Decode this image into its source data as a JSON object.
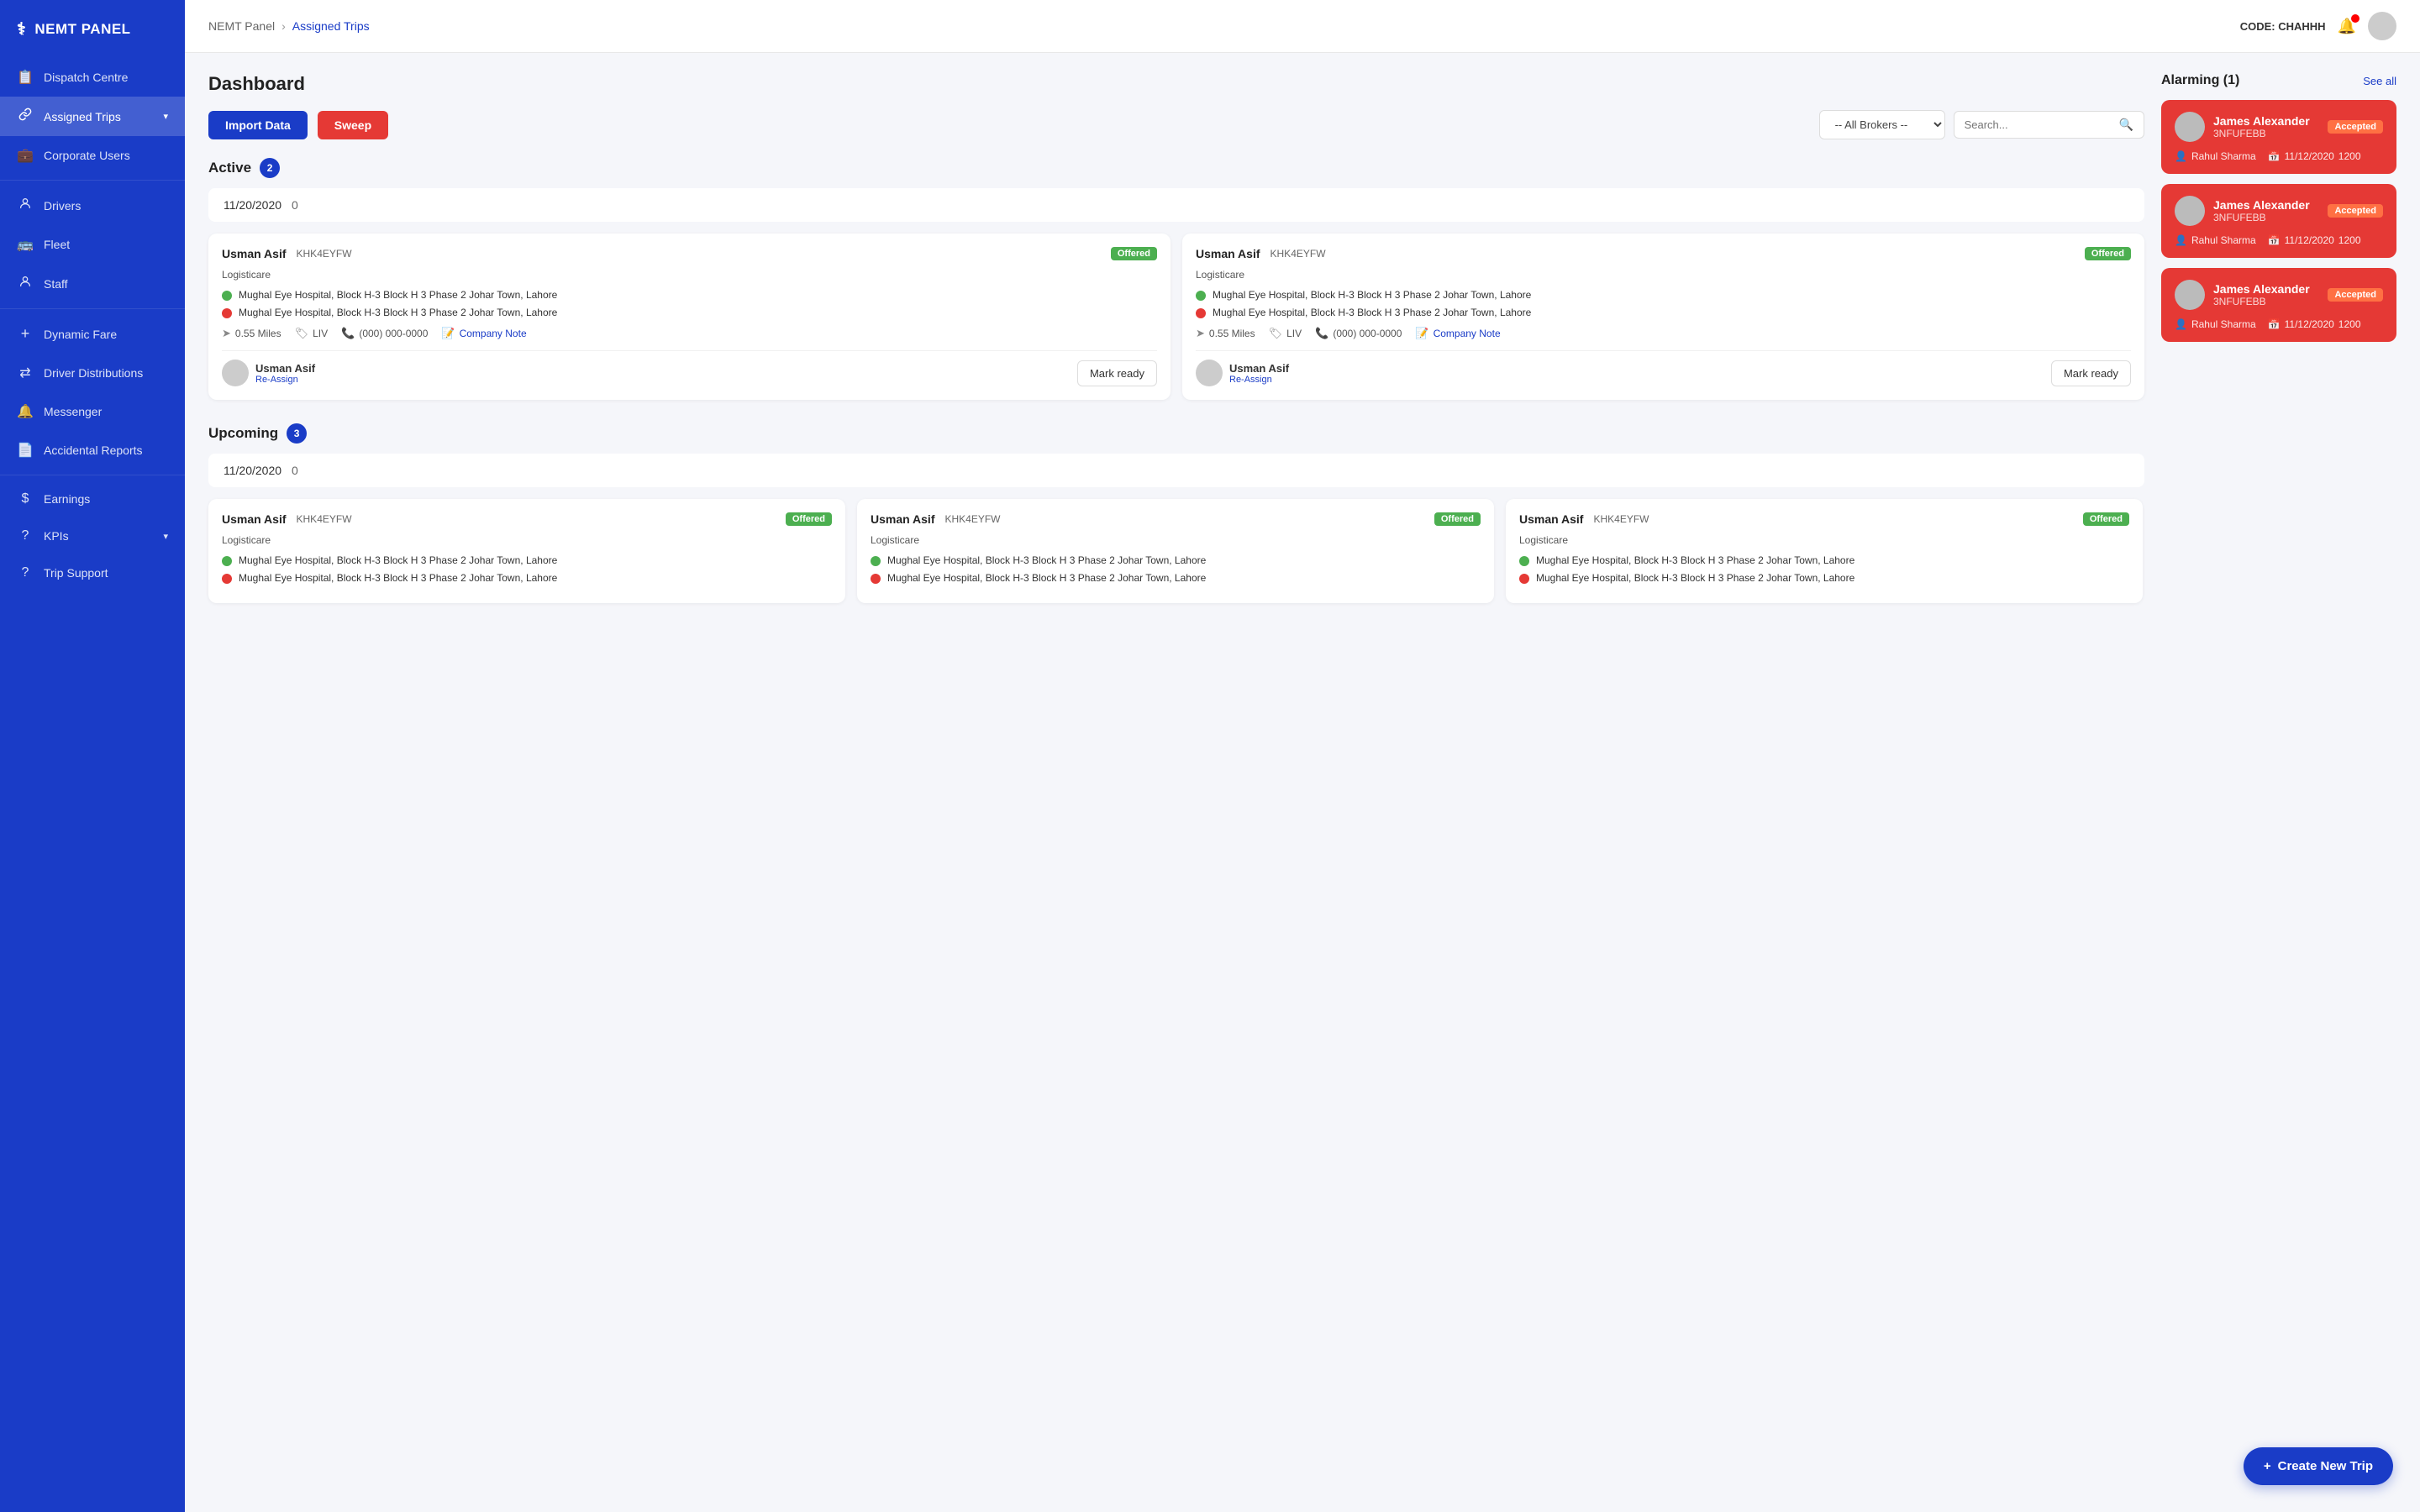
{
  "app": {
    "name": "NEMT PANEL",
    "logo_icon": "⚕"
  },
  "header": {
    "code_label": "CODE: CHAHHH",
    "breadcrumb_parent": "NEMT Panel",
    "breadcrumb_current": "Assigned Trips"
  },
  "sidebar": {
    "items": [
      {
        "id": "dispatch",
        "label": "Dispatch Centre",
        "icon": "📋",
        "active": false
      },
      {
        "id": "assigned-trips",
        "label": "Assigned Trips",
        "icon": "🔗",
        "active": true,
        "has_chevron": true
      },
      {
        "id": "corporate-users",
        "label": "Corporate Users",
        "icon": "💼",
        "active": false
      },
      {
        "id": "drivers",
        "label": "Drivers",
        "icon": "👤",
        "active": false
      },
      {
        "id": "fleet",
        "label": "Fleet",
        "icon": "🚌",
        "active": false
      },
      {
        "id": "staff",
        "label": "Staff",
        "icon": "👥",
        "active": false
      },
      {
        "id": "dynamic-fare",
        "label": "Dynamic Fare",
        "icon": "+",
        "active": false
      },
      {
        "id": "driver-distributions",
        "label": "Driver Distributions",
        "icon": "⇄",
        "active": false
      },
      {
        "id": "messenger",
        "label": "Messenger",
        "icon": "🔔",
        "active": false
      },
      {
        "id": "accidental-reports",
        "label": "Accidental Reports",
        "icon": "📄",
        "active": false
      },
      {
        "id": "earnings",
        "label": "Earnings",
        "icon": "$",
        "active": false
      },
      {
        "id": "kpis",
        "label": "KPIs",
        "icon": "?",
        "active": false,
        "has_chevron": true
      },
      {
        "id": "trip-support",
        "label": "Trip Support",
        "icon": "?",
        "active": false
      }
    ]
  },
  "toolbar": {
    "import_label": "Import Data",
    "sweep_label": "Sweep",
    "broker_placeholder": "-- All Brokers --",
    "search_placeholder": "Search..."
  },
  "dashboard": {
    "title": "Dashboard",
    "active_section": {
      "label": "Active",
      "count": 2,
      "date": "11/20/2020",
      "date_count": "0"
    },
    "upcoming_section": {
      "label": "Upcoming",
      "count": 3,
      "date": "11/20/2020",
      "date_count": "0"
    }
  },
  "active_trips": [
    {
      "driver_name": "Usman Asif",
      "trip_code": "KHK4EYFW",
      "status": "Offered",
      "company": "Logisticare",
      "pickup": "Mughal Eye Hospital, Block H-3 Block H 3 Phase 2 Johar Town, Lahore",
      "dropoff": "Mughal Eye Hospital, Block H-3 Block H 3 Phase 2 Johar Town, Lahore",
      "miles": "0.55 Miles",
      "tag": "LIV",
      "phone": "(000) 000-0000",
      "note_label": "Company Note",
      "assigned_driver": "Usman Asif",
      "reassign_label": "Re-Assign",
      "mark_ready_label": "Mark ready"
    },
    {
      "driver_name": "Usman Asif",
      "trip_code": "KHK4EYFW",
      "status": "Offered",
      "company": "Logisticare",
      "pickup": "Mughal Eye Hospital, Block H-3 Block H 3 Phase 2 Johar Town, Lahore",
      "dropoff": "Mughal Eye Hospital, Block H-3 Block H 3 Phase 2 Johar Town, Lahore",
      "miles": "0.55 Miles",
      "tag": "LIV",
      "phone": "(000) 000-0000",
      "note_label": "Company Note",
      "assigned_driver": "Usman Asif",
      "reassign_label": "Re-Assign",
      "mark_ready_label": "Mark ready"
    }
  ],
  "upcoming_trips": [
    {
      "driver_name": "Usman Asif",
      "trip_code": "KHK4EYFW",
      "status": "Offered",
      "company": "Logisticare",
      "pickup": "Mughal Eye Hospital, Block H-3 Block H 3 Phase 2 Johar Town, Lahore",
      "dropoff": "Mughal Eye Hospital, Block H-3 Block H 3 Phase 2 Johar Town, Lahore"
    },
    {
      "driver_name": "Usman Asif",
      "trip_code": "KHK4EYFW",
      "status": "Offered",
      "company": "Logisticare",
      "pickup": "Mughal Eye Hospital, Block H-3 Block H 3 Phase 2 Johar Town, Lahore",
      "dropoff": "Mughal Eye Hospital, Block H-3 Block H 3 Phase 2 Johar Town, Lahore"
    },
    {
      "driver_name": "Usman Asif",
      "trip_code": "KHK4EYFW",
      "status": "Offered",
      "company": "Logisticare",
      "pickup": "Mughal Eye Hospital, Block H-3 Block H 3 Phase 2 Johar Town, Lahore",
      "dropoff": "Mughal Eye Hospital, Block H-3 Block H 3 Phase 2 Johar Town, Lahore"
    }
  ],
  "alarming": {
    "title": "Alarming (1)",
    "see_all_label": "See all",
    "cards": [
      {
        "name": "James Alexander",
        "status": "Accepted",
        "code": "3NFUFEBB",
        "rider": "Rahul Sharma",
        "date": "11/12/2020",
        "time": "1200"
      },
      {
        "name": "James Alexander",
        "status": "Accepted",
        "code": "3NFUFEBB",
        "rider": "Rahul Sharma",
        "date": "11/12/2020",
        "time": "1200"
      },
      {
        "name": "James Alexander",
        "status": "Accepted",
        "code": "3NFUFEBB",
        "rider": "Rahul Sharma",
        "date": "11/12/2020",
        "time": "1200"
      }
    ]
  },
  "create_trip": {
    "label": "Create New Trip"
  }
}
